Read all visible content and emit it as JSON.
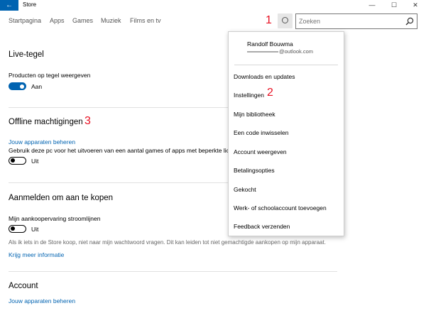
{
  "titlebar": {
    "back_icon": "←",
    "app_title": "Store",
    "minimize": "—",
    "maximize": "☐",
    "close": "✕"
  },
  "nav": {
    "items": [
      "Startpagina",
      "Apps",
      "Games",
      "Muziek",
      "Films en tv"
    ]
  },
  "search": {
    "placeholder": "Zoeken"
  },
  "callouts": {
    "one": "1",
    "two": "2",
    "three": "3"
  },
  "sections": {
    "live_tile": {
      "title": "Live-tegel",
      "setting_label": "Producten op tegel weergeven",
      "toggle_state": "Aan"
    },
    "offline": {
      "title": "Offline machtigingen",
      "link": "Jouw apparaten beheren",
      "setting_label": "Gebruik deze pc voor het uitvoeren van een aantal games of apps met beperkte licer",
      "toggle_state": "Uit"
    },
    "sign_in": {
      "title": "Aanmelden om aan te kopen",
      "setting_label": "Mijn aankoopervaring stroomlijnen",
      "toggle_state": "Uit",
      "description": "Als ik iets in de Store koop, niet naar mijn wachtwoord vragen. Dit kan leiden tot niet gemachtigde aankopen op mijn apparaat.",
      "link": "Krijg meer informatie"
    },
    "account": {
      "title": "Account",
      "link": "Jouw apparaten beheren"
    }
  },
  "dropdown": {
    "user_name": "Randolf Bouwma",
    "email_domain": "@outlook.com",
    "items": [
      "Downloads en updates",
      "Instellingen",
      "Mijn bibliotheek",
      "Een code inwisselen",
      "Account weergeven",
      "Betalingsopties",
      "Gekocht",
      "Werk- of schoolaccount toevoegen",
      "Feedback verzenden"
    ]
  },
  "colors": {
    "accent": "#0063b1",
    "callout": "#e81123"
  }
}
